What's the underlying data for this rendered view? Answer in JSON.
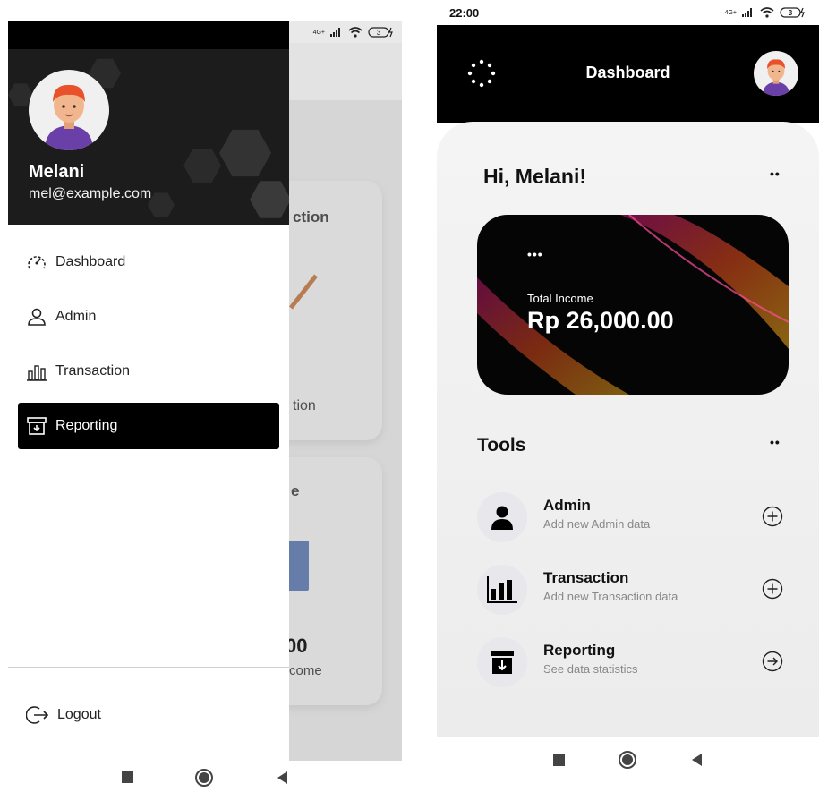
{
  "left": {
    "status": {
      "network": "4G+"
    },
    "bg_cards": {
      "card1_text": "ction",
      "card1_bottom": "tion",
      "card2_text": "e",
      "card2_value": "00",
      "card2_label": "come"
    },
    "user": {
      "name": "Melani",
      "email": "mel@example.com"
    },
    "menu": [
      {
        "label": "Dashboard",
        "icon": "speedometer-icon"
      },
      {
        "label": "Admin",
        "icon": "user-icon"
      },
      {
        "label": "Transaction",
        "icon": "bar-chart-icon"
      },
      {
        "label": "Reporting",
        "icon": "archive-icon",
        "active": true
      }
    ],
    "logout": "Logout"
  },
  "right": {
    "status": {
      "time": "22:00",
      "network": "4G+"
    },
    "header": {
      "title": "Dashboard"
    },
    "greeting": "Hi, Melani!",
    "income": {
      "label": "Total Income",
      "value": "Rp 26,000.00"
    },
    "tools_title": "Tools",
    "tools": [
      {
        "name": "Admin",
        "desc": "Add new Admin data",
        "action": "plus-circle-icon"
      },
      {
        "name": "Transaction",
        "desc": "Add new Transaction data",
        "action": "plus-circle-icon"
      },
      {
        "name": "Reporting",
        "desc": "See data statistics",
        "action": "arrow-right-circle-icon"
      }
    ]
  },
  "colors": {
    "dark": "#000000",
    "drawer_header": "#1c1c1c",
    "muted": "#888888"
  }
}
